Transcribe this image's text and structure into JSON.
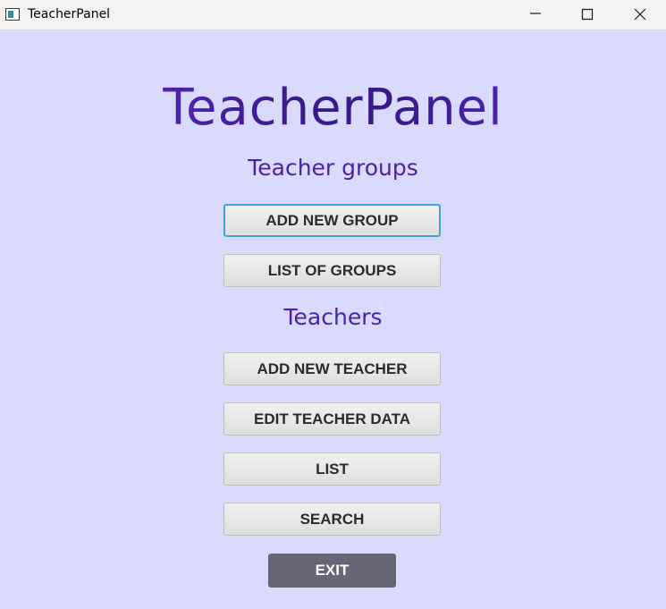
{
  "window": {
    "title": "TeacherPanel"
  },
  "header": {
    "title": "TeacherPanel"
  },
  "groups_section": {
    "title": "Teacher groups",
    "buttons": [
      {
        "label": "ADD NEW GROUP"
      },
      {
        "label": "LIST OF GROUPS"
      }
    ]
  },
  "teachers_section": {
    "title": "Teachers",
    "buttons": [
      {
        "label": "ADD NEW TEACHER"
      },
      {
        "label": "EDIT TEACHER DATA"
      },
      {
        "label": "LIST"
      },
      {
        "label": "SEARCH"
      }
    ]
  },
  "exit_label": "EXIT",
  "colors": {
    "background": "#dadafe",
    "heading": "#5a2ad9",
    "section_title": "#4a22a6",
    "focus_border": "#3aa3e6",
    "exit_button": "#666677"
  },
  "icons": {
    "app": "app-window-icon",
    "minimize": "minimize-icon",
    "maximize": "maximize-icon",
    "close": "close-icon"
  }
}
